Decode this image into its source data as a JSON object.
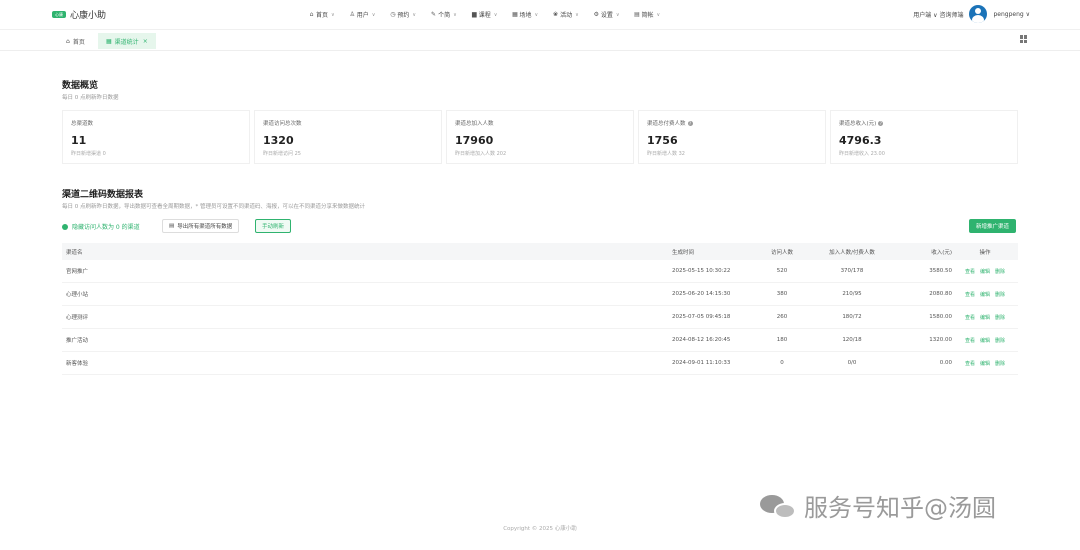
{
  "app": {
    "logo_badge": "心康",
    "name": "心康小助"
  },
  "nav": [
    {
      "icon": "home-icon",
      "glyph": "⌂",
      "label": "首页"
    },
    {
      "icon": "user-icon",
      "glyph": "♙",
      "label": "用户"
    },
    {
      "icon": "calendar-icon",
      "glyph": "◷",
      "label": "预约"
    },
    {
      "icon": "edit-icon",
      "glyph": "✎",
      "label": "个简"
    },
    {
      "icon": "book-icon",
      "glyph": "▆",
      "label": "课程"
    },
    {
      "icon": "venue-icon",
      "glyph": "▦",
      "label": "场地"
    },
    {
      "icon": "activity-icon",
      "glyph": "❀",
      "label": "活动"
    },
    {
      "icon": "gear-icon",
      "glyph": "⚙",
      "label": "设置"
    },
    {
      "icon": "list-icon",
      "glyph": "▤",
      "label": "简帐"
    }
  ],
  "user": {
    "role": "用户端 ∨ 咨询师端",
    "name": "pengpeng"
  },
  "tabs": {
    "home": "首页",
    "active": "渠道统计"
  },
  "overview": {
    "title": "数据概览",
    "subtitle": "每日 0 点刷新昨日数据",
    "cards": [
      {
        "label": "总渠道数",
        "value": "11",
        "foot": "昨日新增渠道 0"
      },
      {
        "label": "渠道访问总次数",
        "value": "1320",
        "foot": "昨日新增访问 25"
      },
      {
        "label": "渠道总加入人数",
        "value": "17960",
        "foot": "昨日新增加入人数 202"
      },
      {
        "label": "渠道总付费人数",
        "value": "1756",
        "foot": "昨日新增人数 32"
      },
      {
        "label": "渠道总收入(元)",
        "value": "4796.3",
        "foot": "昨日新增收入 23.00"
      }
    ]
  },
  "report": {
    "title": "渠道二维码数据报表",
    "subtitle": "每日 0 点刷新昨日数据，导出数据可查看全周期数据，* 管理员可设置不同渠道码、海报，可以在不同渠道分享来做数据统计",
    "hint": "隐藏访问人数为 0 的渠道",
    "btn_export": "导出所有渠道所有数据",
    "btn_refresh": "手动刷新",
    "btn_add": "新增推广渠道",
    "columns": [
      "渠道名",
      "生成时间",
      "访问人数",
      "加入人数/付费人数",
      "收入(元)",
      "操作"
    ],
    "rows": [
      {
        "name": "官网推广",
        "time": "2025-05-15 10:30:22",
        "visits": "520",
        "join_pay": "370/178",
        "income": "3580.50",
        "ops": [
          "查看",
          "编辑",
          "删除"
        ]
      },
      {
        "name": "心理小站",
        "time": "2025-06-20 14:15:30",
        "visits": "380",
        "join_pay": "210/95",
        "income": "2080.80",
        "ops": [
          "查看",
          "编辑",
          "删除"
        ]
      },
      {
        "name": "心理测评",
        "time": "2025-07-05 09:45:18",
        "visits": "260",
        "join_pay": "180/72",
        "income": "1580.00",
        "ops": [
          "查看",
          "编辑",
          "删除"
        ]
      },
      {
        "name": "推广活动",
        "time": "2024-08-12 16:20:45",
        "visits": "180",
        "join_pay": "120/18",
        "income": "1320.00",
        "ops": [
          "查看",
          "编辑",
          "删除"
        ]
      },
      {
        "name": "新客体验",
        "time": "2024-09-01 11:10:33",
        "visits": "0",
        "join_pay": "0/0",
        "income": "0.00",
        "ops": [
          "查看",
          "编辑",
          "删除"
        ]
      }
    ]
  },
  "footer": "Copyright © 2025 心康小助",
  "watermark": "服务号知乎@汤圆"
}
